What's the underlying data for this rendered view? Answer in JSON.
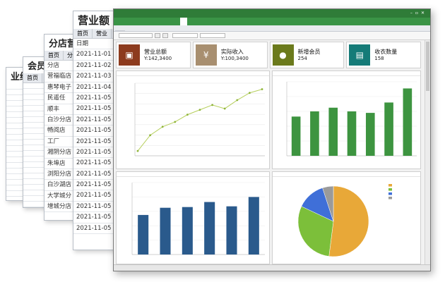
{
  "bg_windows": [
    {
      "title": "业绩",
      "tabs": [],
      "rows": [
        "",
        "",
        "",
        "",
        "",
        "",
        "",
        "",
        "",
        "",
        "",
        "",
        "",
        "",
        "",
        "",
        "",
        "",
        "",
        "",
        "",
        ""
      ]
    },
    {
      "title": "会员消",
      "tabs": [
        "首页",
        "会员"
      ],
      "rows": [
        "",
        "",
        "",
        "",
        "",
        "",
        "",
        "",
        "",
        "",
        "",
        "",
        "",
        "",
        "",
        "",
        "",
        "",
        "",
        "",
        "",
        ""
      ]
    },
    {
      "title": "分店营",
      "tabs": [
        "首页",
        "分"
      ],
      "rows": [
        "分店",
        "营福临店",
        "惠琴电子",
        "民遥任",
        "顺丰",
        "白沙分店",
        "畅阅店",
        "工厂",
        "湘阴分店",
        "朱埠店",
        "浏阳分店",
        "白沙湖店",
        "大学城分",
        "增城分店"
      ]
    },
    {
      "title": "营业额",
      "tabs": [
        "首页",
        "营业"
      ],
      "rows": [
        "日期",
        "2021-11-01",
        "2021-11-02",
        "2021-11-03",
        "2021-11-04",
        "2021-11-05",
        "2021-11-05",
        "2021-11-05",
        "2021-11-05",
        "2021-11-05",
        "2021-11-05",
        "2021-11-05",
        "2021-11-05",
        "2021-11-05",
        "2021-11-05",
        "2021-11-05",
        "2021-11-05",
        "2021-11-05"
      ]
    }
  ],
  "main": {
    "title": "",
    "menu": [
      "",
      "",
      "",
      "",
      "",
      "",
      "",
      "",
      "",
      "",
      "",
      "",
      "",
      "",
      "",
      "",
      ""
    ],
    "active_menu_index": 9,
    "tab": "",
    "toolbar": {
      "branch_label": "",
      "branch_value": "",
      "buttons": [
        "",
        ""
      ],
      "date_label": "",
      "date_from": "",
      "date_to": ""
    },
    "cards": [
      {
        "label": "营业总额",
        "value": "Y:142,3400",
        "color": "#8d3b1e",
        "icon": "wallet-icon"
      },
      {
        "label": "实际收入",
        "value": "Y:100,3400",
        "color": "#a88f70",
        "icon": "money-bag-icon"
      },
      {
        "label": "新增会员",
        "value": "254",
        "color": "#6b7a1c",
        "icon": "user-icon"
      },
      {
        "label": "收衣数量",
        "value": "158",
        "color": "#157b78",
        "icon": "shirt-icon"
      }
    ],
    "panels": {
      "line": "",
      "bar_top": "",
      "bar_bottom": "",
      "pie": ""
    },
    "status": {
      "left": "",
      "right": ""
    }
  },
  "colors": {
    "title_green": "#2f7c38",
    "menu_green": "#3a9446",
    "line": "#b6cf5c",
    "bar_green": "#3d9440",
    "bar_blue": "#2a5a8c",
    "pie": [
      "#e8a838",
      "#7cbf3a",
      "#3f6fd8",
      "#9a9a9a"
    ]
  },
  "chart_data": [
    {
      "type": "line",
      "x": [
        "",
        "",
        "",
        "",
        "",
        "",
        "",
        "",
        "",
        "",
        ""
      ],
      "values": [
        20,
        85,
        120,
        140,
        170,
        190,
        210,
        195,
        230,
        260,
        275
      ],
      "ylim": [
        0,
        300
      ],
      "yticks": [
        "",
        "",
        "",
        "",
        "",
        "",
        "",
        ""
      ],
      "grid": true
    },
    {
      "type": "bar",
      "categories": [
        "",
        "",
        "",
        "",
        "",
        "",
        ""
      ],
      "values": [
        53,
        60,
        65,
        60,
        58,
        72,
        91
      ],
      "ylim": [
        0,
        100
      ],
      "color": "#3d9440"
    },
    {
      "type": "bar",
      "categories": [
        "",
        "",
        "",
        "",
        "",
        "",
        ""
      ],
      "values": [
        55,
        65,
        66,
        73,
        67,
        80
      ],
      "ylim": [
        0,
        100
      ],
      "color": "#2a5a8c"
    },
    {
      "type": "pie",
      "labels": [
        "",
        "",
        "",
        ""
      ],
      "values": [
        52,
        30,
        13,
        5
      ],
      "legend": "top-right"
    }
  ]
}
